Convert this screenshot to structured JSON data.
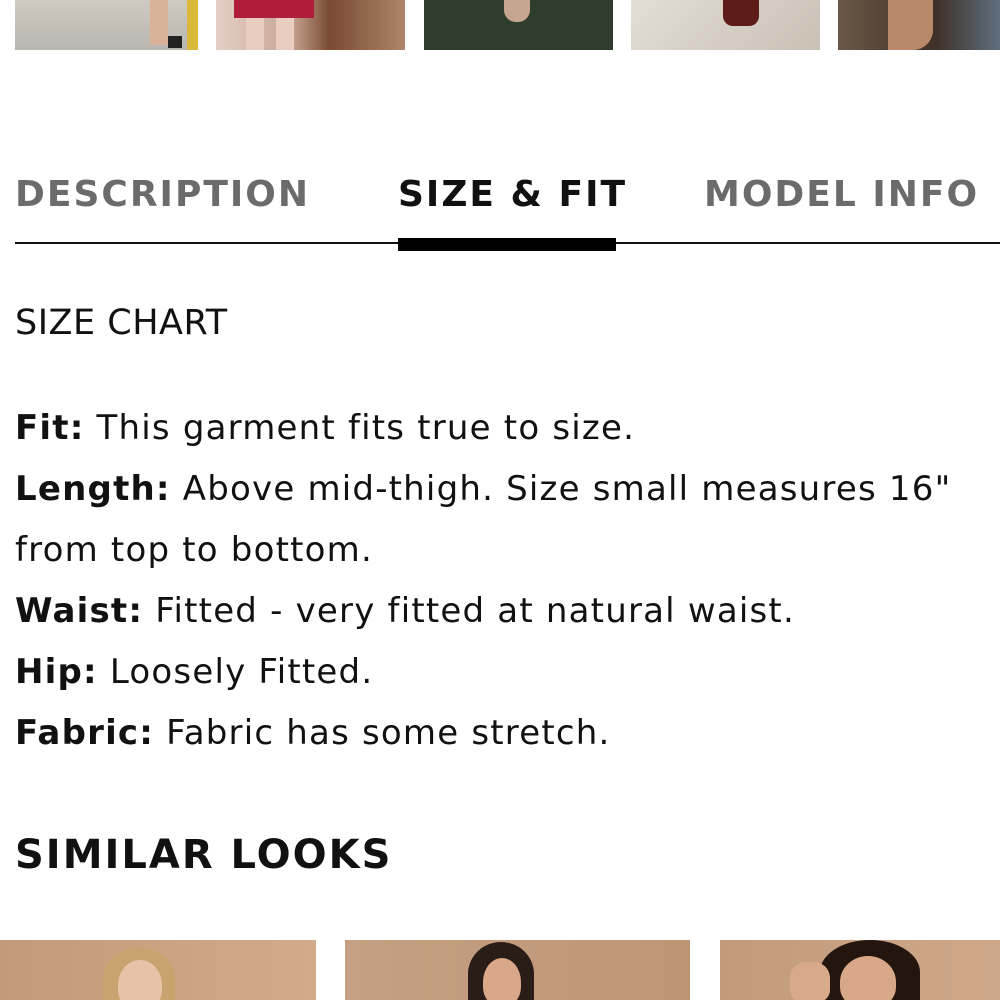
{
  "tabs": {
    "description": "DESCRIPTION",
    "size_fit": "SIZE & FIT",
    "model_info": "MODEL INFO",
    "active": "SIZE & FIT"
  },
  "size_chart": {
    "label": "SIZE CHART"
  },
  "fit_details": [
    {
      "label": "Fit:",
      "text": "This garment fits true to size."
    },
    {
      "label": "Length:",
      "text": "Above mid-thigh. Size small measures 16\" from top to bottom."
    },
    {
      "label": "Waist:",
      "text": "Fitted - very fitted at natural waist."
    },
    {
      "label": "Hip:",
      "text": "Loosely Fitted."
    },
    {
      "label": "Fabric:",
      "text": "Fabric has some stretch."
    }
  ],
  "similar_looks": {
    "heading": "SIMILAR LOOKS",
    "products": [
      {
        "image": "product-photo-blonde-model"
      },
      {
        "image": "product-photo-brunette-model"
      },
      {
        "image": "product-photo-dark-haired-model"
      }
    ]
  },
  "thumbnails": [
    {
      "image": "customer-photo-legs-on-pavement"
    },
    {
      "image": "customer-photo-red-dress-on-deck"
    },
    {
      "image": "customer-photo-on-grass"
    },
    {
      "image": "customer-photo-red-shoes-on-tile"
    },
    {
      "image": "customer-photo-sitting"
    }
  ],
  "colors": {
    "text": "#111111",
    "inactive_tab": "#6b6b6b",
    "tab_indicator": "#000000",
    "background": "#ffffff"
  }
}
